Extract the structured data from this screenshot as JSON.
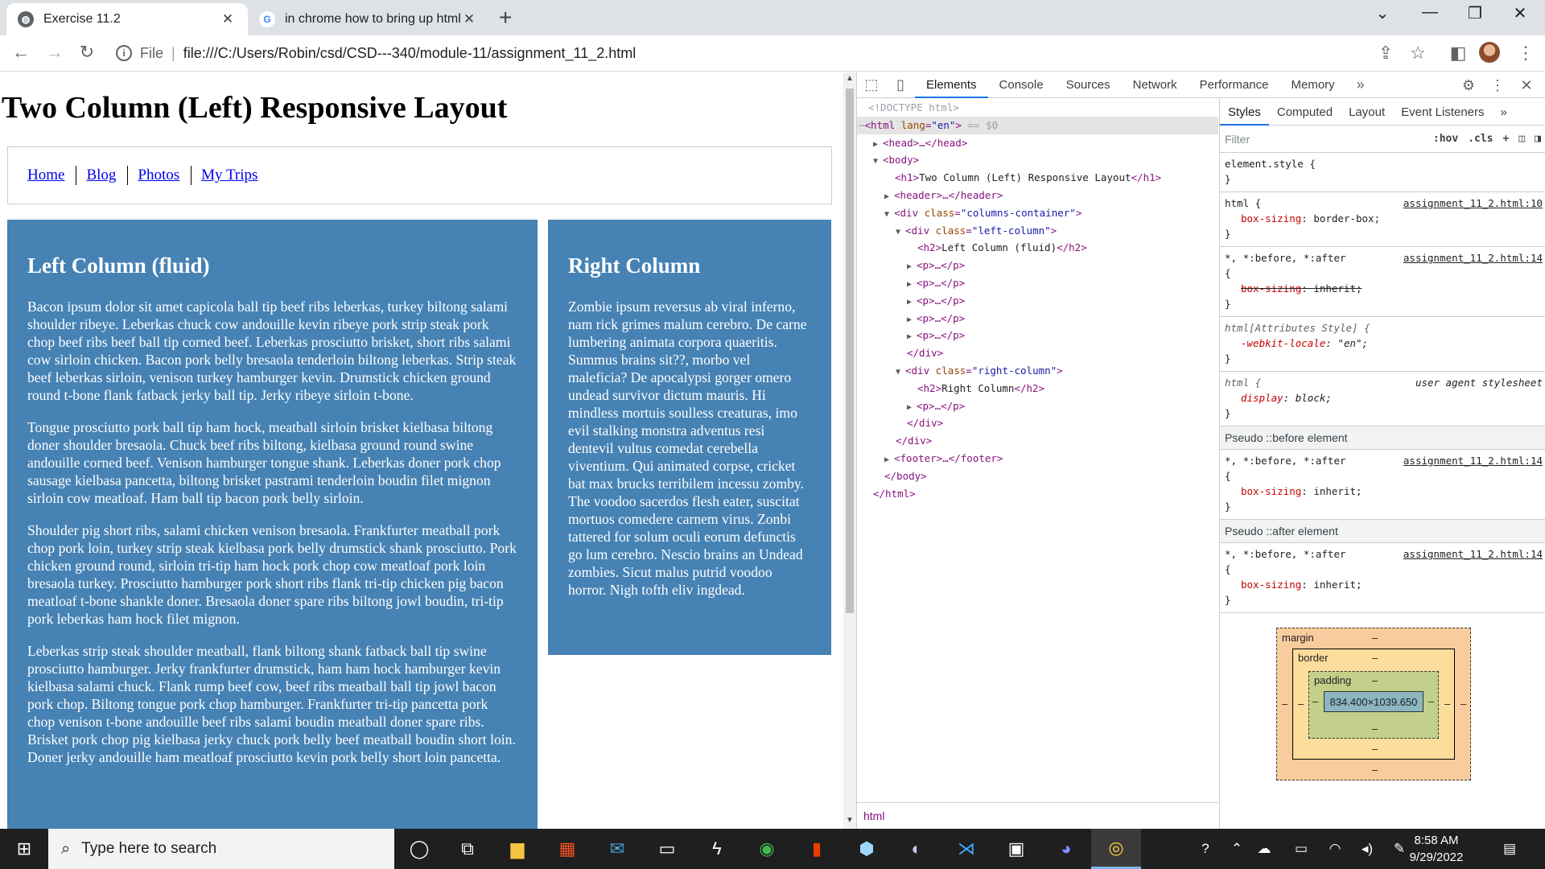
{
  "browser": {
    "tabs": [
      {
        "title": "Exercise 11.2",
        "active": true
      },
      {
        "title": "in chrome how to bring up html e",
        "active": false
      }
    ],
    "address": {
      "scheme_label": "File",
      "url": "file:///C:/Users/Robin/csd/CSD---340/module-11/assignment_11_2.html"
    }
  },
  "page": {
    "title": "Two Column (Left) Responsive Layout",
    "nav": [
      "Home",
      "Blog",
      "Photos",
      "My Trips"
    ],
    "left_column": {
      "heading": "Left Column (fluid)",
      "paragraphs": [
        "Bacon ipsum dolor sit amet capicola ball tip beef ribs leberkas, turkey biltong salami shoulder ribeye. Leberkas chuck cow andouille kevin ribeye pork strip steak pork chop beef ribs beef ball tip corned beef. Leberkas prosciutto brisket, short ribs salami cow sirloin chicken. Bacon pork belly bresaola tenderloin biltong leberkas. Strip steak beef leberkas sirloin, venison turkey hamburger kevin. Drumstick chicken ground round t-bone flank fatback jerky ball tip. Jerky ribeye sirloin t-bone.",
        "Tongue prosciutto pork ball tip ham hock, meatball sirloin brisket kielbasa biltong doner shoulder bresaola. Chuck beef ribs biltong, kielbasa ground round swine andouille corned beef. Venison hamburger tongue shank. Leberkas doner pork chop sausage kielbasa pancetta, biltong brisket pastrami tenderloin boudin filet mignon sirloin cow meatloaf. Ham ball tip bacon pork belly sirloin.",
        "Shoulder pig short ribs, salami chicken venison bresaola. Frankfurter meatball pork chop pork loin, turkey strip steak kielbasa pork belly drumstick shank prosciutto. Pork chicken ground round, sirloin tri-tip ham hock pork chop cow meatloaf pork loin bresaola turkey. Prosciutto hamburger pork short ribs flank tri-tip chicken pig bacon meatloaf t-bone shankle doner. Bresaola doner spare ribs biltong jowl boudin, tri-tip pork leberkas ham hock filet mignon.",
        "Leberkas strip steak shoulder meatball, flank biltong shank fatback ball tip swine prosciutto hamburger. Jerky frankfurter drumstick, ham ham hock hamburger kevin kielbasa salami chuck. Flank rump beef cow, beef ribs meatball ball tip jowl bacon pork chop. Biltong tongue pork chop hamburger. Frankfurter tri-tip pancetta pork chop venison t-bone andouille beef ribs salami boudin meatball doner spare ribs. Brisket pork chop pig kielbasa jerky chuck pork belly beef meatball boudin short loin. Doner jerky andouille ham meatloaf prosciutto kevin pork belly short loin pancetta."
      ]
    },
    "right_column": {
      "heading": "Right Column",
      "paragraphs": [
        "Zombie ipsum reversus ab viral inferno, nam rick grimes malum cerebro. De carne lumbering animata corpora quaeritis. Summus brains sit??, morbo vel maleficia? De apocalypsi gorger omero undead survivor dictum mauris. Hi mindless mortuis soulless creaturas, imo evil stalking monstra adventus resi dentevil vultus comedat cerebella viventium. Qui animated corpse, cricket bat max brucks terribilem incessu zomby. The voodoo sacerdos flesh eater, suscitat mortuos comedere carnem virus. Zonbi tattered for solum oculi eorum defunctis go lum cerebro. Nescio brains an Undead zombies. Sicut malus putrid voodoo horror. Nigh tofth eliv ingdead."
      ]
    }
  },
  "devtools": {
    "tabs": [
      "Elements",
      "Console",
      "Sources",
      "Network",
      "Performance",
      "Memory"
    ],
    "active_tab": "Elements",
    "dom": {
      "doctype": "<!DOCTYPE html>",
      "html_open": "<html",
      "html_attr": "lang",
      "html_attr_val": "\"en\"",
      "html_close_bracket": ">",
      "selected_marker": "== $0",
      "head": "<head>…</head>",
      "body_open": "<body>",
      "h1_open": "<h1>",
      "h1_text": "Two Column (Left) Responsive Layout",
      "h1_close": "</h1>",
      "header": "<header>…</header>",
      "div_open": "<div",
      "class_attr": "class",
      "columns_container": "\"columns-container\"",
      "left_column": "\"left-column\"",
      "right_column": "\"right-column\"",
      "h2_open": "<h2>",
      "h2_close": "</h2>",
      "h2_left_text": "Left Column (fluid)",
      "h2_right_text": "Right Column",
      "p_collapsed": "<p>…</p>",
      "div_close": "</div>",
      "footer": "<footer>…</footer>",
      "body_close": "</body>",
      "html_end": "</html>"
    },
    "breadcrumb": "html",
    "styles_tabs": [
      "Styles",
      "Computed",
      "Layout",
      "Event Listeners"
    ],
    "filter_placeholder": "Filter",
    "filter_options": [
      ":hov",
      ".cls"
    ],
    "rules": {
      "element_style": "element.style {",
      "html_selector": "html {",
      "html_source": "assignment_11_2.html:10",
      "box_sizing_prop": "box-sizing",
      "border_box_val": "border-box;",
      "universal_selector": "*, *:before, *:after",
      "universal_source": "assignment_11_2.html:14",
      "inherit_val": "inherit;",
      "attr_style_selector": "html[Attributes Style] {",
      "locale_prop": "-webkit-locale",
      "locale_val": "\"en\";",
      "ua_selector": "html {",
      "ua_label": "user agent stylesheet",
      "display_prop": "display",
      "display_val": "block;",
      "pseudo_before": "Pseudo ::before element",
      "pseudo_after": "Pseudo ::after element"
    },
    "box_model": {
      "margin_label": "margin",
      "border_label": "border",
      "padding_label": "padding",
      "dash": "–",
      "content_size": "834.400×1039.650"
    }
  },
  "taskbar": {
    "search_placeholder": "Type here to search",
    "time": "8:58 AM",
    "date": "9/29/2022"
  }
}
